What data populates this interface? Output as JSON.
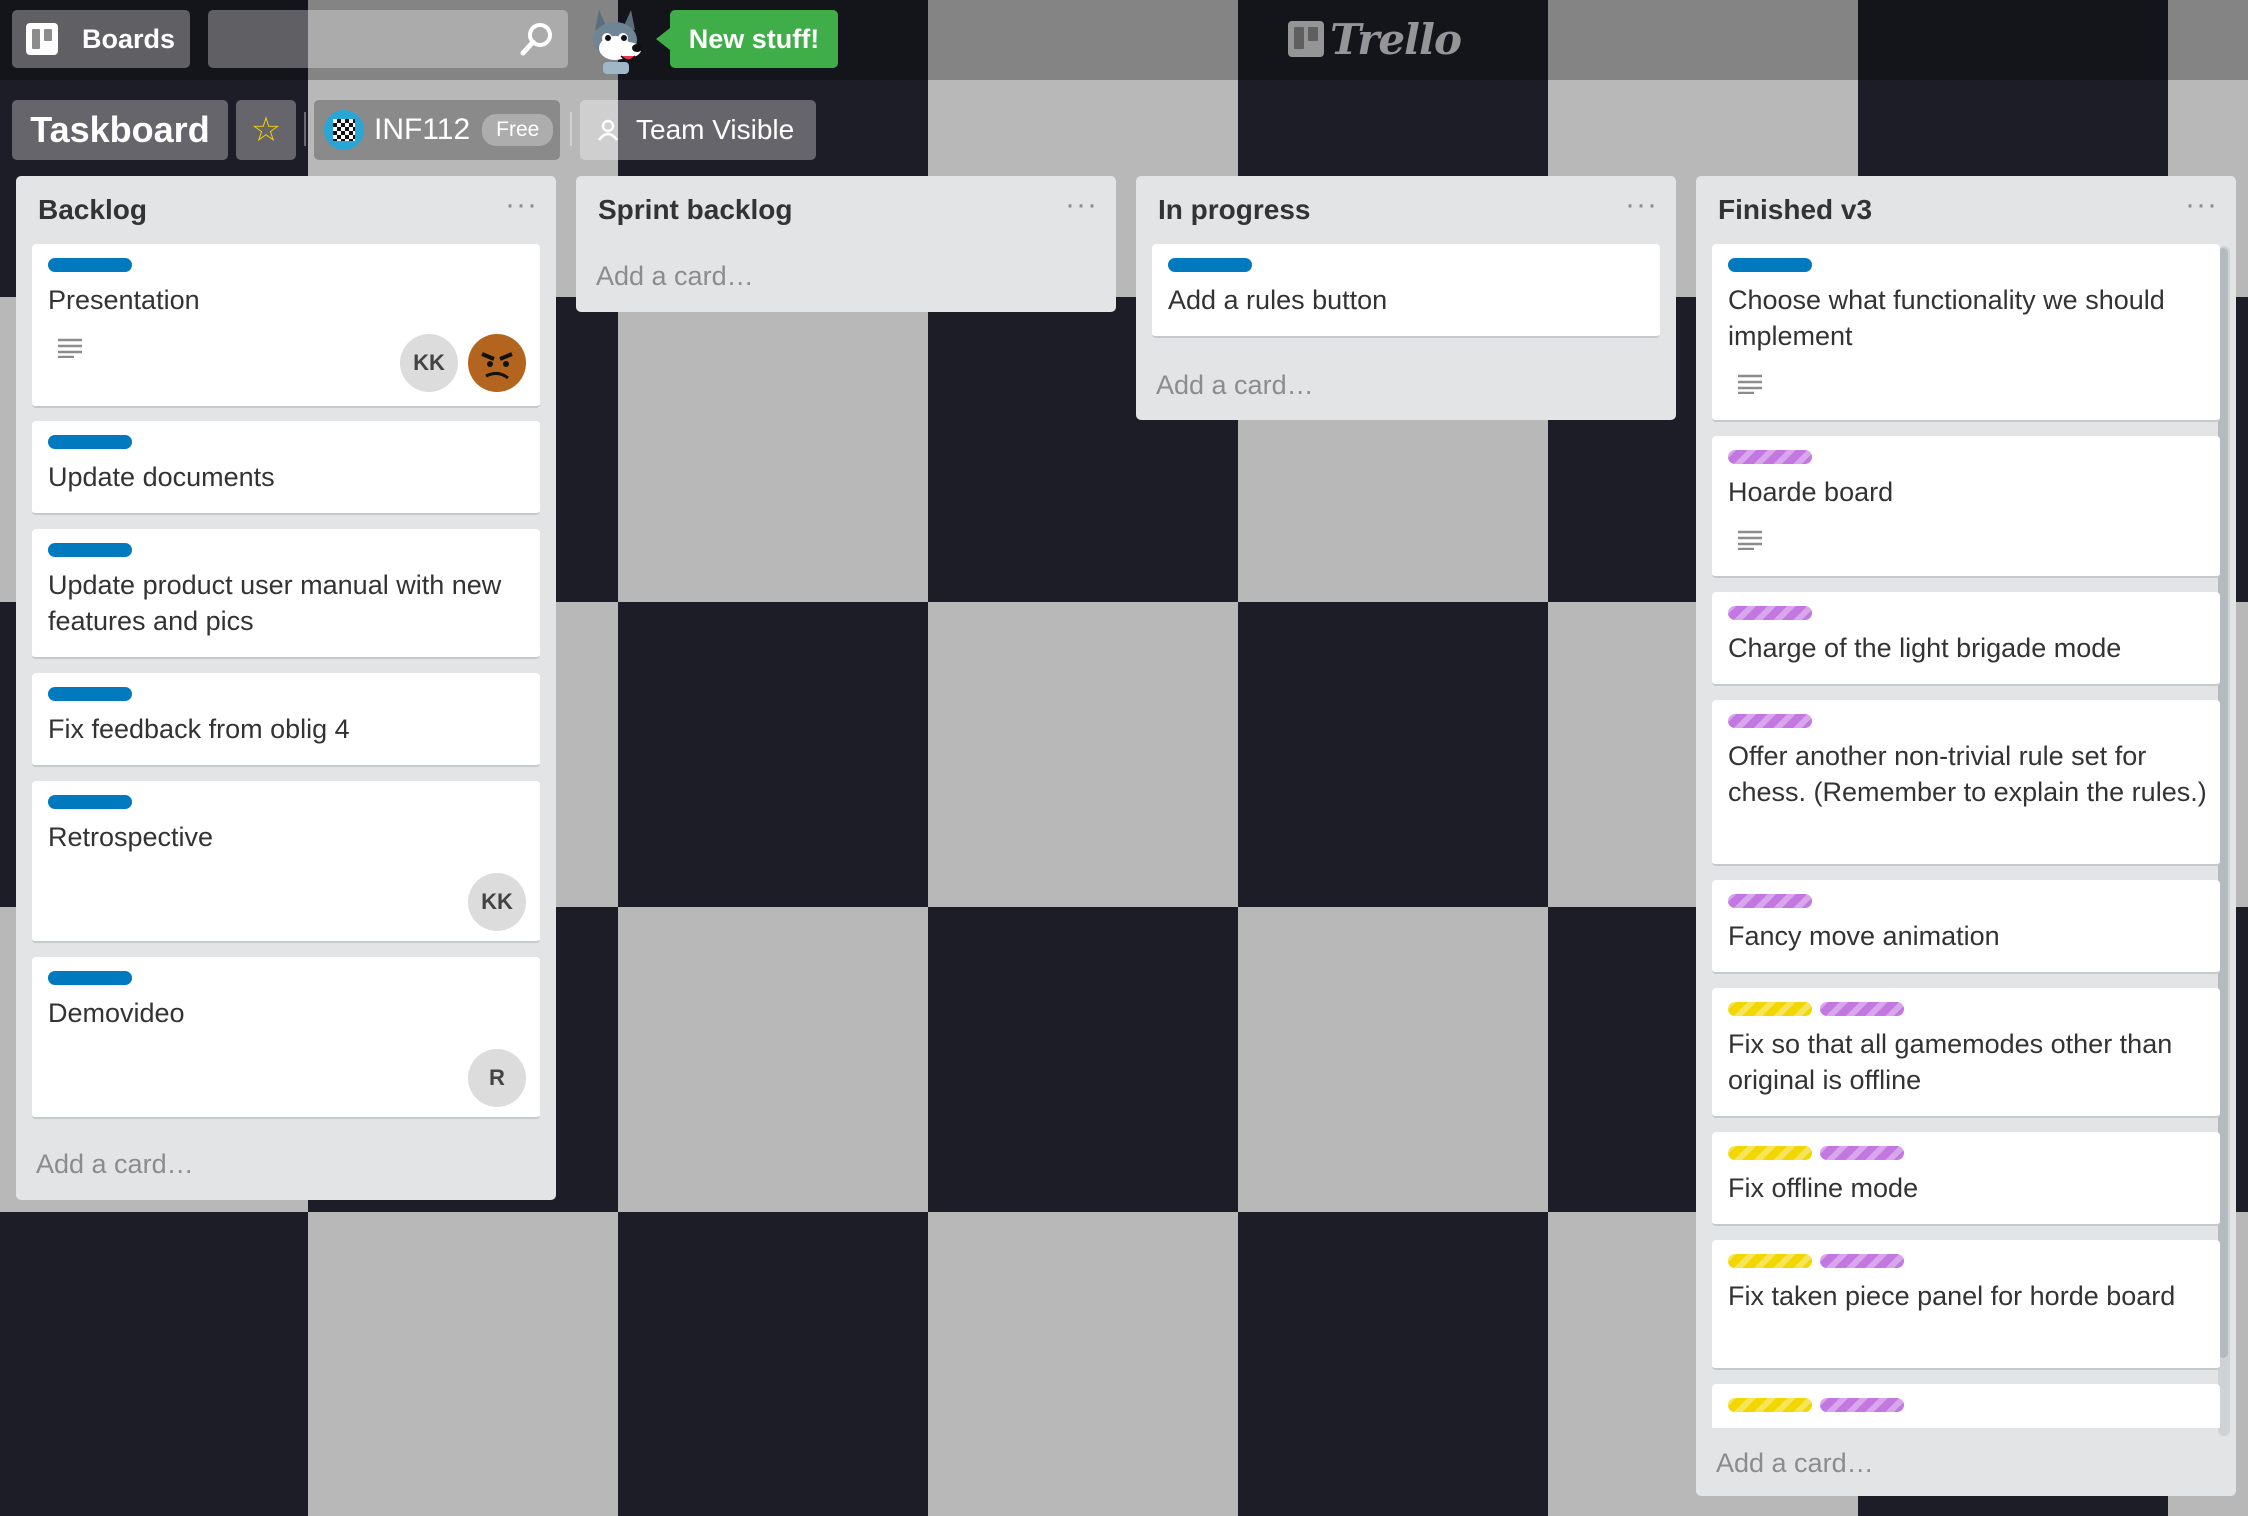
{
  "header": {
    "boards_label": "Boards",
    "search_placeholder": "",
    "new_stuff_label": "New stuff!",
    "logo_text": "Trello"
  },
  "board": {
    "name": "Taskboard",
    "team_name": "INF112",
    "plan_badge": "Free",
    "visibility_label": "Team Visible"
  },
  "colors": {
    "blue_label": "#0079bf",
    "purple_label": "#c377e0",
    "yellow_label": "#f2d600",
    "green_button": "#3fae49"
  },
  "lists": [
    {
      "title": "Backlog",
      "add_card": "Add a card…",
      "cards": [
        {
          "labels": [
            "blue"
          ],
          "title": "Presentation",
          "has_description": true,
          "members": [
            "KK",
            "avatar-photo"
          ]
        },
        {
          "labels": [
            "blue"
          ],
          "title": "Update documents"
        },
        {
          "labels": [
            "blue"
          ],
          "title": "Update product user manual with new features and pics"
        },
        {
          "labels": [
            "blue"
          ],
          "title": "Fix feedback from oblig 4"
        },
        {
          "labels": [
            "blue"
          ],
          "title": "Retrospective",
          "members": [
            "KK"
          ]
        },
        {
          "labels": [
            "blue"
          ],
          "title": "Demovideo",
          "members": [
            "R"
          ]
        }
      ]
    },
    {
      "title": "Sprint backlog",
      "add_card": "Add a card…",
      "cards": []
    },
    {
      "title": "In progress",
      "add_card": "Add a card…",
      "cards": [
        {
          "labels": [
            "blue"
          ],
          "title": "Add a rules button"
        }
      ]
    },
    {
      "title": "Finished v3",
      "add_card": "Add a card…",
      "cards": [
        {
          "labels": [
            "blue"
          ],
          "title": "Choose what functionality we should implement",
          "has_description": true
        },
        {
          "labels": [
            "purple"
          ],
          "title": "Hoarde board",
          "has_description": true
        },
        {
          "labels": [
            "purple"
          ],
          "title": "Charge of the light brigade mode"
        },
        {
          "labels": [
            "purple"
          ],
          "title": "Offer another non-trivial rule set for chess. (Remember to explain the rules.)"
        },
        {
          "labels": [
            "purple"
          ],
          "title": "Fancy move animation"
        },
        {
          "labels": [
            "yellow",
            "purple"
          ],
          "title": "Fix so that all gamemodes other than original is offline"
        },
        {
          "labels": [
            "yellow",
            "purple"
          ],
          "title": "Fix offline mode"
        },
        {
          "labels": [
            "yellow",
            "purple"
          ],
          "title": "Fix taken piece panel for horde board"
        },
        {
          "labels": [
            "yellow",
            "purple"
          ],
          "title": ""
        }
      ]
    }
  ]
}
